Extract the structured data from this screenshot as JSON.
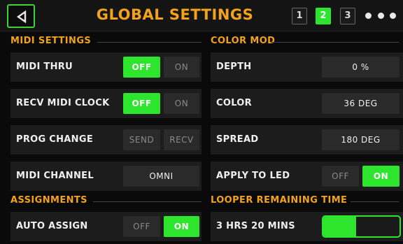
{
  "header": {
    "title": "GLOBAL SETTINGS",
    "pages": [
      "1",
      "2",
      "3"
    ],
    "active_page": "2",
    "back_icon": "back-arrow-icon",
    "more_icon": "more-dots-icon"
  },
  "midi_settings": {
    "title": "MIDI SETTINGS",
    "midi_thru": {
      "label": "MIDI THRU",
      "off": "OFF",
      "on": "ON",
      "selected": "OFF"
    },
    "recv_midi_clock": {
      "label": "RECV MIDI CLOCK",
      "off": "OFF",
      "on": "ON",
      "selected": "OFF"
    },
    "prog_change": {
      "label": "PROG CHANGE",
      "send": "SEND",
      "recv": "RECV",
      "selected": ""
    },
    "midi_channel": {
      "label": "MIDI CHANNEL",
      "value": "OMNI"
    }
  },
  "color_mod": {
    "title": "COLOR MOD",
    "depth": {
      "label": "DEPTH",
      "value": "0 %"
    },
    "color": {
      "label": "COLOR",
      "value": "36 DEG"
    },
    "spread": {
      "label": "SPREAD",
      "value": "180 DEG"
    },
    "apply_to_led": {
      "label": "APPLY TO LED",
      "off": "OFF",
      "on": "ON",
      "selected": "ON"
    }
  },
  "assignments": {
    "title": "ASSIGNMENTS",
    "auto_assign": {
      "label": "AUTO ASSIGN",
      "off": "OFF",
      "on": "ON",
      "selected": "ON"
    }
  },
  "looper": {
    "title": "LOOPER REMAINING TIME",
    "remaining": "3 HRS 20 MINS",
    "fraction_remaining": 0.44
  },
  "colors": {
    "accent_orange": "#f2a21b",
    "active_green": "#2ee52e",
    "background": "#0a0a0a",
    "row_background": "#1c1c1c"
  }
}
